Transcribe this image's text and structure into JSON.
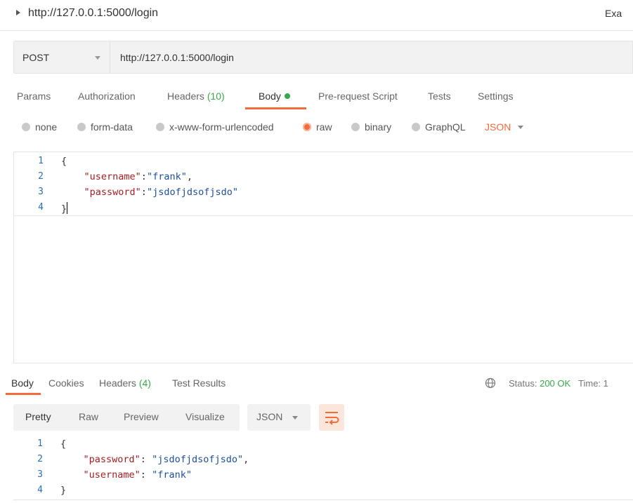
{
  "window": {
    "title": "http://127.0.0.1:5000/login",
    "right_text": "Exa"
  },
  "request": {
    "method": "POST",
    "url": "http://127.0.0.1:5000/login",
    "tabs": [
      {
        "label": "Params"
      },
      {
        "label": "Authorization"
      },
      {
        "label": "Headers",
        "count": "(10)"
      },
      {
        "label": "Body"
      },
      {
        "label": "Pre-request Script"
      },
      {
        "label": "Tests"
      },
      {
        "label": "Settings"
      }
    ],
    "body_options": [
      "none",
      "form-data",
      "x-www-form-urlencoded",
      "raw",
      "binary",
      "GraphQL"
    ],
    "body_format": "JSON",
    "line_numbers": [
      "1",
      "2",
      "3",
      "4"
    ],
    "lines": [
      {
        "open": "{"
      },
      {
        "key": "\"username\"",
        "sep": ":",
        "val": "\"frank\"",
        "end": ","
      },
      {
        "key": "\"password\"",
        "sep": ":",
        "val": "\"jsdofjdsofjsdo\"",
        "end": ""
      },
      {
        "close": "}"
      }
    ]
  },
  "response": {
    "tabs": [
      {
        "label": "Body"
      },
      {
        "label": "Cookies"
      },
      {
        "label": "Headers",
        "count": "(4)"
      },
      {
        "label": "Test Results"
      }
    ],
    "status_label": "Status:",
    "status_value": "200 OK",
    "time_label": "Time: 1",
    "view_modes": [
      "Pretty",
      "Raw",
      "Preview",
      "Visualize"
    ],
    "format": "JSON",
    "line_numbers": [
      "1",
      "2",
      "3",
      "4"
    ],
    "lines": [
      {
        "open": "{"
      },
      {
        "key": "\"password\"",
        "sep": ": ",
        "val": "\"jsdofjdsofjsdo\"",
        "end": ","
      },
      {
        "key": "\"username\"",
        "sep": ": ",
        "val": "\"frank\"",
        "end": ""
      },
      {
        "close": "}"
      }
    ]
  },
  "colors": {
    "accent": "#f26b3a",
    "success": "#38a84a",
    "json_key": "#a61d24",
    "json_string": "#1d4f9c"
  },
  "icons": {
    "globe": "globe-icon",
    "wrap": "word-wrap-icon"
  }
}
